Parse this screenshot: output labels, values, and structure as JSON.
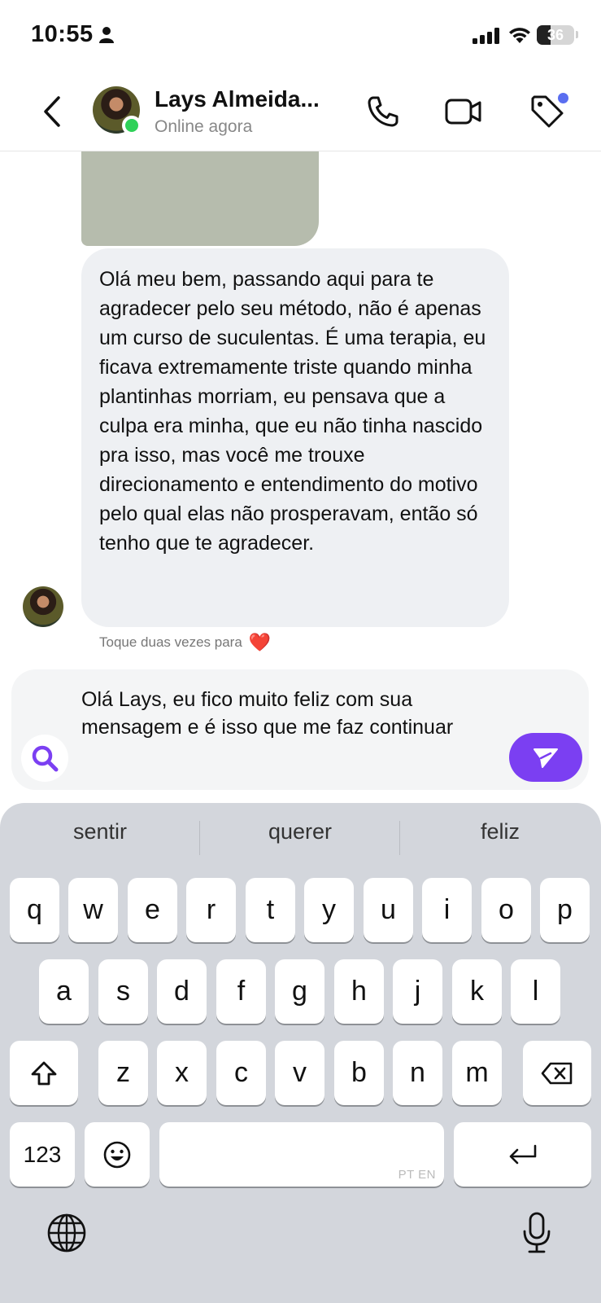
{
  "status_bar": {
    "time": "10:55",
    "battery": "36",
    "battery_level": 0.36
  },
  "header": {
    "name": "Lays Almeida...",
    "status": "Online agora"
  },
  "chat": {
    "message_text": "Olá meu bem, passando aqui para te agradecer pelo seu método, não é apenas um curso de suculentas. É uma terapia, eu ficava extremamente triste quando minha plantinhas morriam, eu pensava que a culpa era minha, que eu não tinha nascido pra isso, mas você me trouxe direcionamento e entendimento do motivo pelo qual elas não prosperavam, então só tenho que te agradecer.",
    "double_tap_hint": "Toque duas vezes para",
    "reaction": "❤️"
  },
  "composer": {
    "text": "Olá Lays, eu fico muito feliz com sua mensagem e é isso que me faz continuar"
  },
  "keyboard": {
    "suggestions": [
      "sentir",
      "querer",
      "feliz"
    ],
    "row1": [
      "q",
      "w",
      "e",
      "r",
      "t",
      "y",
      "u",
      "i",
      "o",
      "p"
    ],
    "row2": [
      "a",
      "s",
      "d",
      "f",
      "g",
      "h",
      "j",
      "k",
      "l"
    ],
    "row3": [
      "z",
      "x",
      "c",
      "v",
      "b",
      "n",
      "m"
    ],
    "numbers_label": "123",
    "space_hint": "PT EN"
  },
  "colors": {
    "accent": "#7b3ff2",
    "online": "#2fd158",
    "notification_dot": "#5a6ef0",
    "bubble": "#eef0f3"
  }
}
